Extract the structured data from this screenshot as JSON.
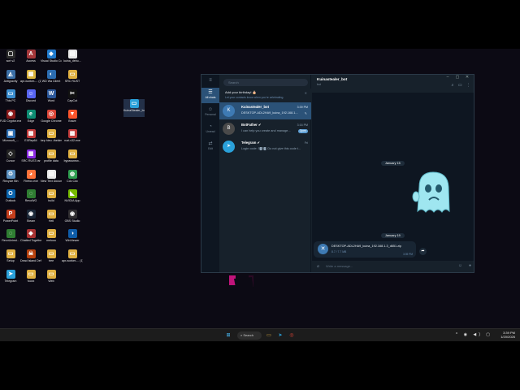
{
  "desktop": {
    "icons": [
      {
        "label": "scrt v2",
        "glyph": "▢",
        "color": "#2b2b2b"
      },
      {
        "label": "Access",
        "glyph": "A",
        "color": "#a4373a"
      },
      {
        "label": "Visual Studio Code",
        "glyph": "◆",
        "color": "#1f7acc"
      },
      {
        "label": "kuina_debu...",
        "glyph": "▤",
        "color": "#e8e8e8"
      },
      {
        "label": "Antigravity",
        "glyph": "◭",
        "color": "#3a6ea5"
      },
      {
        "label": "apr-worker-... (1).zip",
        "glyph": "▦",
        "color": "#d8b13a"
      },
      {
        "label": "WD Wa Client",
        "glyph": "◐",
        "color": "#2b6cb0"
      },
      {
        "label": "SRC RUST",
        "glyph": "▭",
        "color": "#e0b040"
      },
      {
        "label": "This PC",
        "glyph": "▭",
        "color": "#3b8ed0"
      },
      {
        "label": "Discord",
        "glyph": "☺",
        "color": "#5865f2"
      },
      {
        "label": "Word",
        "glyph": "W",
        "color": "#2b579a"
      },
      {
        "label": "CapCut",
        "glyph": "✂",
        "color": "#111111"
      },
      {
        "label": "FUD Cryptor.exe",
        "glyph": "◉",
        "color": "#8b1a1a"
      },
      {
        "label": "Edge",
        "glyph": "e",
        "color": "#0c8c72"
      },
      {
        "label": "Google Chrome",
        "glyph": "◎",
        "color": "#db4437"
      },
      {
        "label": "Brave",
        "glyph": "▼",
        "color": "#fb542b"
      },
      {
        "label": "Microsoft_...",
        "glyph": "▣",
        "color": "#2b6cb0"
      },
      {
        "label": "EXRep64",
        "glyph": "▩",
        "color": "#c23b3b"
      },
      {
        "label": "kep hieu -thekim",
        "glyph": "▭",
        "color": "#e0b040"
      },
      {
        "label": "rust.v32.exe",
        "glyph": "▩",
        "color": "#c23b3b"
      },
      {
        "label": "Cursor",
        "glyph": "◇",
        "color": "#222222"
      },
      {
        "label": "SRC RUST.rar",
        "glyph": "▦",
        "color": "#8a2be2"
      },
      {
        "label": "profile data",
        "glyph": "▭",
        "color": "#e0b040"
      },
      {
        "label": "bypassnew...",
        "glyph": "▭",
        "color": "#e0b040"
      },
      {
        "label": "Recycle Bin",
        "glyph": "♲",
        "color": "#5a8fbf"
      },
      {
        "label": "Firefox.exe",
        "glyph": "◕",
        "color": "#ff7139"
      },
      {
        "label": "New Text Document.txt",
        "glyph": "▤",
        "color": "#e8e8e8"
      },
      {
        "label": "Cốc Cốc",
        "glyph": "◍",
        "color": "#2e9d4f"
      },
      {
        "label": "Outlook",
        "glyph": "O",
        "color": "#0a64ad"
      },
      {
        "label": "RevoWG",
        "glyph": "◌",
        "color": "#2f7d32"
      },
      {
        "label": "build",
        "glyph": "▭",
        "color": "#e0b040"
      },
      {
        "label": "NVIDIA App",
        "glyph": "◣",
        "color": "#76b900"
      },
      {
        "label": "PowerPoint",
        "glyph": "P",
        "color": "#c43e1c"
      },
      {
        "label": "Steam",
        "glyph": "◉",
        "color": "#1b2838"
      },
      {
        "label": "Hell",
        "glyph": "▭",
        "color": "#e0b040"
      },
      {
        "label": "OBS Studio",
        "glyph": "◉",
        "color": "#302e31"
      },
      {
        "label": "RevoUninst...",
        "glyph": "◌",
        "color": "#2f7d32"
      },
      {
        "label": "Chatted Together",
        "glyph": "◆",
        "color": "#a83232"
      },
      {
        "label": "melooo",
        "glyph": "▭",
        "color": "#e0b040"
      },
      {
        "label": "WinViewer",
        "glyph": "◑",
        "color": "#0e5ca8"
      },
      {
        "label": "Setup",
        "glyph": "▭",
        "color": "#e0b040"
      },
      {
        "label": "Dead Island Definitive...",
        "glyph": "☠",
        "color": "#b7410e"
      },
      {
        "label": "tree",
        "glyph": "▭",
        "color": "#e0b040"
      },
      {
        "label": "apr-worker-... (1)",
        "glyph": "▭",
        "color": "#e0b040"
      },
      {
        "label": "Telegram",
        "glyph": "➤",
        "color": "#2aa1da"
      },
      {
        "label": "fooxx",
        "glyph": "▭",
        "color": "#e0b040"
      },
      {
        "label": "Web",
        "glyph": "▭",
        "color": "#e0b040"
      }
    ],
    "dragging_icon": {
      "label": "KuinaStealer_bot",
      "glyph": "▭",
      "color": "#2aa1da"
    }
  },
  "telegram": {
    "search_placeholder": "Search",
    "window_controls": [
      "–",
      "▢",
      "✕"
    ],
    "rail": [
      {
        "icon": "chat-icon",
        "glyph": "☰",
        "label": "All chats",
        "active": true
      },
      {
        "icon": "person-icon",
        "glyph": "☺",
        "label": "Personal",
        "active": false
      },
      {
        "icon": "unread-icon",
        "glyph": "◔",
        "label": "Unread",
        "active": false
      },
      {
        "icon": "edit-icon",
        "glyph": "⇄",
        "label": "Edit",
        "active": false
      }
    ],
    "birthday_banner": {
      "title": "Add your birthday! 🎂",
      "subtitle": "Let your contacts know when you're celebrating."
    },
    "chats": [
      {
        "name": "Kuinastealer_bot",
        "time": "3:39 PM",
        "preview": "DESKTOP-ADL2HA9_kuina_192.168.1...",
        "avatar": "K",
        "avatar_color": "#3e7ab3",
        "active": true,
        "badge": "",
        "pinned": true
      },
      {
        "name": "BotFather ✔",
        "time": "3:16 PM",
        "preview": "I can help you create and manage...",
        "avatar": "B",
        "avatar_color": "#4a4a4a",
        "active": false,
        "badge": "Open",
        "pinned": false
      },
      {
        "name": "Telegram ✔",
        "time": "Fri",
        "preview": "Login code: 5█5█. Do not give this code t...",
        "avatar": "➤",
        "avatar_color": "#2aa1da",
        "active": false,
        "badge": "",
        "pinned": false
      }
    ],
    "header": {
      "name": "Kuinastealer_bot",
      "status": "bot",
      "tools": [
        "⌕",
        "▭",
        "⋮"
      ]
    },
    "dates": [
      "January 15",
      "January 19"
    ],
    "file_message": {
      "filename": "DESKTOP-ADL2HA9_kuina_192.168.1.3_d651.zip",
      "size": "8.7 / 7.7 MB",
      "time": "3:39 PM"
    },
    "compose_placeholder": "Write a message..."
  },
  "taskbar": {
    "search_label": "Search",
    "time": "3:39 PM",
    "date": "1/20/2026",
    "tray": "^ ◉ ◀) ▢"
  }
}
